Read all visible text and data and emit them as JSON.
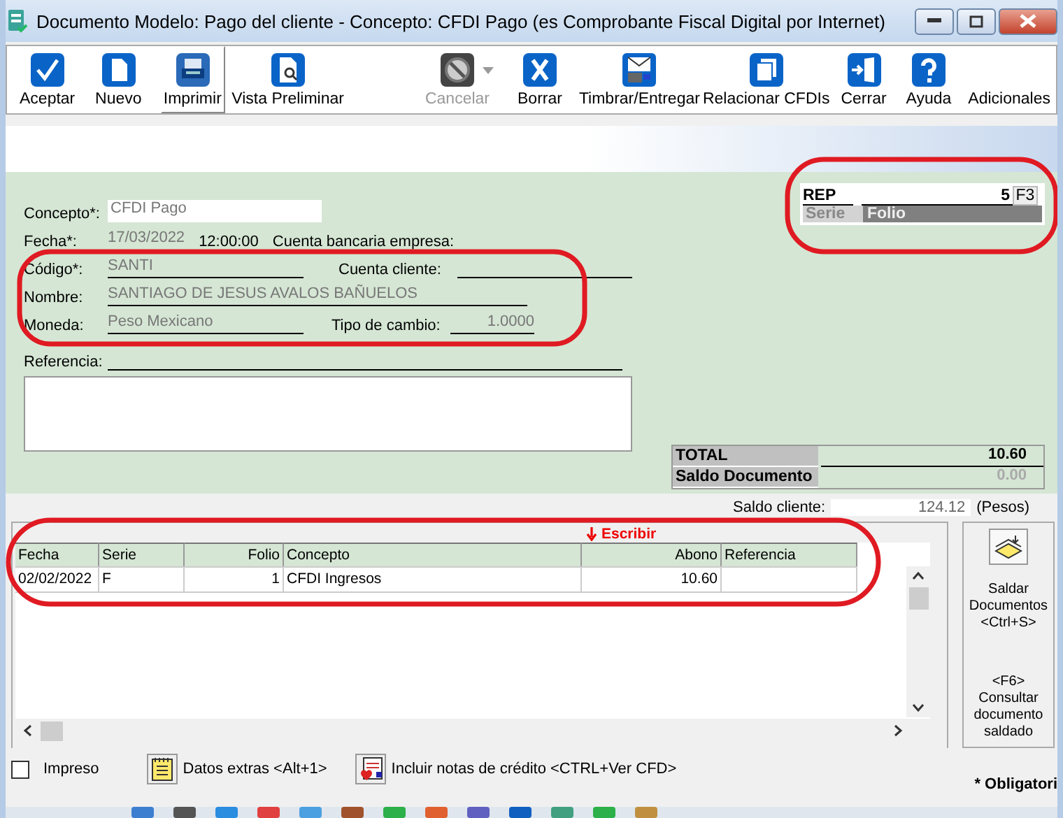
{
  "window": {
    "title": "Documento Modelo: Pago del cliente - Concepto: CFDI Pago (es Comprobante Fiscal Digital por Internet)"
  },
  "toolbar": {
    "buttons": [
      {
        "label": "Aceptar",
        "disabled": false,
        "pressed": false,
        "dropdown": false
      },
      {
        "label": "Nuevo",
        "disabled": false,
        "pressed": false,
        "dropdown": false
      },
      {
        "label": "Imprimir",
        "disabled": false,
        "pressed": true,
        "dropdown": false
      },
      {
        "label": "Vista Preliminar",
        "disabled": false,
        "pressed": false,
        "dropdown": false
      },
      {
        "label": "Cancelar",
        "disabled": true,
        "pressed": false,
        "dropdown": true
      },
      {
        "label": "Borrar",
        "disabled": false,
        "pressed": false,
        "dropdown": false
      },
      {
        "label": "Timbrar/Entregar",
        "disabled": false,
        "pressed": false,
        "dropdown": false
      },
      {
        "label": "Relacionar CFDIs",
        "disabled": false,
        "pressed": false,
        "dropdown": false
      },
      {
        "label": "Cerrar",
        "disabled": false,
        "pressed": false,
        "dropdown": false
      },
      {
        "label": "Ayuda",
        "disabled": false,
        "pressed": false,
        "dropdown": false
      }
    ],
    "extra": "Adicionales"
  },
  "form": {
    "concepto": {
      "label": "Concepto*:",
      "value": "CFDI Pago"
    },
    "fecha": {
      "label": "Fecha*:",
      "value": "17/03/2022",
      "time": "12:00:00"
    },
    "cuenta_bancaria": {
      "label": "Cuenta bancaria empresa:"
    },
    "codigo": {
      "label": "Código*:",
      "value": "SANTI"
    },
    "cuenta_cliente": {
      "label": "Cuenta cliente:"
    },
    "nombre": {
      "label": "Nombre:",
      "value": "SANTIAGO DE JESUS AVALOS BAÑUELOS"
    },
    "moneda": {
      "label": "Moneda:",
      "value": "Peso Mexicano"
    },
    "tipo_cambio": {
      "label": "Tipo de cambio:",
      "value": "1.0000"
    },
    "referencia": {
      "label": "Referencia:"
    }
  },
  "folio_box": {
    "serie": "REP",
    "folio": "5",
    "button": "F3",
    "serie_caption": "Serie",
    "folio_caption": "Folio"
  },
  "totals": [
    {
      "label": "TOTAL",
      "value": "10.60"
    },
    {
      "label": "Saldo Documento",
      "value": "0.00"
    }
  ],
  "saldo_cliente": {
    "label": "Saldo cliente:",
    "value": "124.12",
    "unit": "(Pesos)"
  },
  "annotation": {
    "text": "Escribir"
  },
  "table": {
    "columns": [
      "Fecha",
      "Serie",
      "Folio",
      "Concepto",
      "Abono",
      "Referencia"
    ],
    "rows": [
      [
        "02/02/2022",
        "F",
        "1",
        "CFDI Ingresos",
        "10.60",
        ""
      ]
    ]
  },
  "side_buttons": [
    "Saldar Documentos <Ctrl+S>",
    "<F6> Consultar documento saldado"
  ],
  "bottom": {
    "impreso": {
      "label": "Impreso",
      "checked": false
    },
    "datos_extras": "Datos extras  <Alt+1>",
    "notas_credito": "Incluir notas de crédito <CTRL+Ver CFD>",
    "required_note": "* Obligatori"
  }
}
